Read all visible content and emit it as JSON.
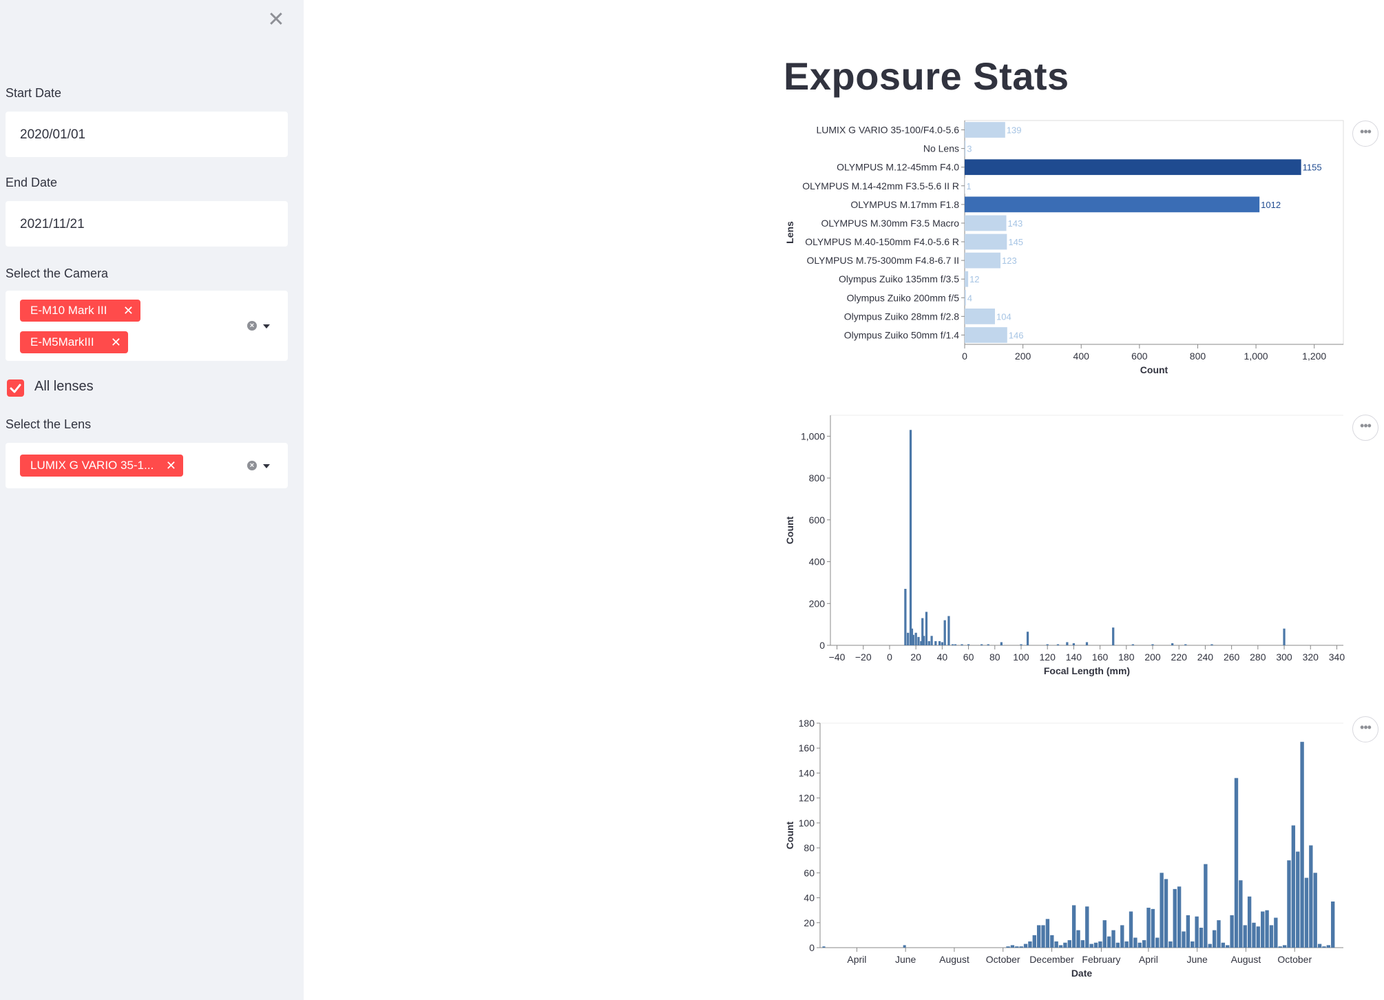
{
  "sidebar": {
    "close_icon": "close-icon",
    "start_date": {
      "label": "Start Date",
      "value": "2020/01/01"
    },
    "end_date": {
      "label": "End Date",
      "value": "2021/11/21"
    },
    "camera": {
      "label": "Select the Camera",
      "selected": [
        "E-M10 Mark III",
        "E-M5MarkIII"
      ]
    },
    "all_lenses": {
      "label": "All lenses",
      "checked": true
    },
    "lens": {
      "label": "Select the Lens",
      "selected": [
        "LUMIX G VARIO 35-1..."
      ]
    }
  },
  "main": {
    "title": "Exposure Stats"
  },
  "colors": {
    "accent": "#ff4b4b",
    "bar": "#4c78a8",
    "bar_light": "#c1d6ec",
    "bar_dark": "#1f4b90"
  },
  "chart_data": [
    {
      "type": "bar",
      "orientation": "horizontal",
      "ylabel": "Lens",
      "xlabel": "Count",
      "xlim": [
        0,
        1300
      ],
      "xticks": [
        0,
        200,
        400,
        600,
        800,
        1000,
        1200
      ],
      "xtick_labels": [
        "0",
        "200",
        "400",
        "600",
        "800",
        "1,000",
        "1,200"
      ],
      "categories": [
        "LUMIX G VARIO 35-100/F4.0-5.6",
        "No Lens",
        "OLYMPUS M.12-45mm F4.0",
        "OLYMPUS M.14-42mm F3.5-5.6 II R",
        "OLYMPUS M.17mm F1.8",
        "OLYMPUS M.30mm F3.5 Macro",
        "OLYMPUS M.40-150mm F4.0-5.6 R",
        "OLYMPUS M.75-300mm F4.8-6.7 II",
        "Olympus Zuiko 135mm f/3.5",
        "Olympus Zuiko 200mm f/5",
        "Olympus Zuiko 28mm f/2.8",
        "Olympus Zuiko 50mm f/1.4"
      ],
      "values": [
        139,
        3,
        1155,
        1,
        1012,
        143,
        145,
        123,
        12,
        4,
        104,
        146
      ],
      "data_labels": [
        "139",
        "3",
        "1155",
        "1",
        "1012",
        "143",
        "145",
        "123",
        "12",
        "4",
        "104",
        "146"
      ]
    },
    {
      "type": "bar",
      "xlabel": "Focal Length (mm)",
      "ylabel": "Count",
      "xlim": [
        -45,
        345
      ],
      "ylim": [
        0,
        1100
      ],
      "xticks": [
        -40,
        -20,
        0,
        20,
        40,
        60,
        80,
        100,
        120,
        140,
        160,
        180,
        200,
        220,
        240,
        260,
        280,
        300,
        320,
        340
      ],
      "xtick_labels": [
        "−40",
        "−20",
        "0",
        "20",
        "40",
        "60",
        "80",
        "100",
        "120",
        "140",
        "160",
        "180",
        "200",
        "220",
        "240",
        "260",
        "280",
        "300",
        "320",
        "340"
      ],
      "yticks": [
        0,
        200,
        400,
        600,
        800,
        1000
      ],
      "ytick_labels": [
        "0",
        "200",
        "400",
        "600",
        "800",
        "1,000"
      ],
      "x": [
        12,
        14,
        16,
        17,
        18,
        20,
        22,
        24,
        25,
        26,
        28,
        30,
        32,
        35,
        38,
        40,
        42,
        45,
        48,
        50,
        55,
        60,
        70,
        75,
        85,
        100,
        105,
        120,
        128,
        135,
        140,
        150,
        170,
        185,
        200,
        215,
        225,
        245,
        300
      ],
      "values": [
        270,
        60,
        1030,
        80,
        50,
        60,
        40,
        20,
        130,
        45,
        160,
        20,
        45,
        20,
        20,
        15,
        120,
        140,
        5,
        5,
        5,
        5,
        5,
        5,
        15,
        5,
        65,
        5,
        5,
        15,
        10,
        15,
        85,
        5,
        5,
        10,
        5,
        5,
        80
      ]
    },
    {
      "type": "bar",
      "xlabel": "Date",
      "ylabel": "Count",
      "ylim": [
        0,
        180
      ],
      "yticks": [
        0,
        20,
        40,
        60,
        80,
        100,
        120,
        140,
        160,
        180
      ],
      "xtick_labels": [
        "April",
        "June",
        "August",
        "October",
        "December",
        "February",
        "April",
        "June",
        "August",
        "October"
      ],
      "x_dates": [
        "2020-03-04",
        "2020-05-29",
        "2021-05-11",
        "2021-05-26",
        "2021-07-29",
        "2021-09-02",
        "2021-09-16",
        "2021-10-07",
        "2021-11-11"
      ],
      "values": [
        1,
        2,
        6,
        67,
        136,
        27,
        72,
        165,
        38
      ],
      "note_values": [
        1,
        2,
        1,
        1,
        3,
        5,
        10,
        18,
        18,
        23,
        10,
        5,
        2,
        4,
        6,
        34,
        14,
        6,
        33,
        3,
        4,
        5,
        22,
        9,
        14,
        4,
        18,
        5,
        29,
        8,
        4,
        6,
        32,
        31,
        8,
        60,
        55,
        5,
        47,
        49,
        13,
        26,
        5,
        25,
        16,
        67,
        3,
        14,
        22,
        4,
        2,
        26,
        136,
        54,
        18,
        41,
        20,
        17,
        29,
        30,
        18,
        24,
        1,
        2,
        70,
        98,
        77,
        165,
        56,
        82,
        60,
        3,
        1,
        2,
        37
      ]
    }
  ]
}
